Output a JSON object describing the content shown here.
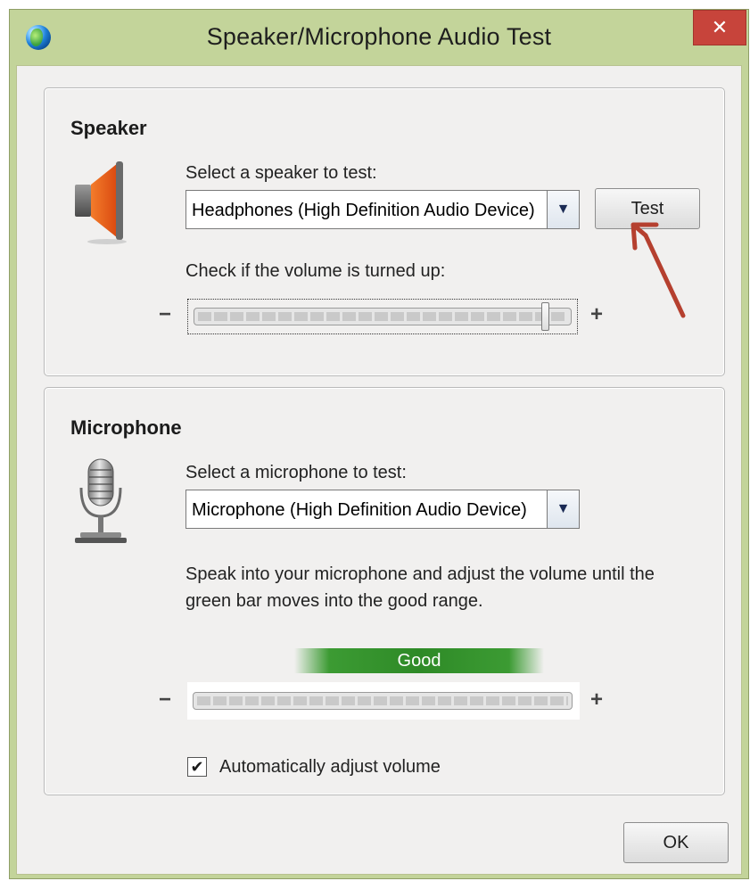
{
  "window": {
    "title": "Speaker/Microphone Audio Test",
    "close_glyph": "✕",
    "icon": "globe-icon"
  },
  "speaker": {
    "heading": "Speaker",
    "select_label": "Select a speaker to test:",
    "selected_device": "Headphones (High Definition Audio Device)",
    "test_label": "Test",
    "volume_label": "Check if the volume is turned up:",
    "volume_level": 0.94,
    "minus": "−",
    "plus": "+",
    "icon": "speaker-icon"
  },
  "microphone": {
    "heading": "Microphone",
    "select_label": "Select a microphone to test:",
    "selected_device": "Microphone (High Definition Audio Device)",
    "instructions_line1": "Speak into your microphone and adjust the volume until the",
    "instructions_line2": "green bar moves into the good range.",
    "good_label": "Good",
    "minus": "−",
    "plus": "+",
    "auto_adjust_label": "Automatically adjust volume",
    "auto_adjust_checked": true,
    "icon": "microphone-icon"
  },
  "footer": {
    "ok_label": "OK"
  },
  "colors": {
    "frame": "#c3d49a",
    "close": "#c7443b",
    "good_bar": "#2e8a27",
    "annotation_arrow": "#b5402f"
  }
}
